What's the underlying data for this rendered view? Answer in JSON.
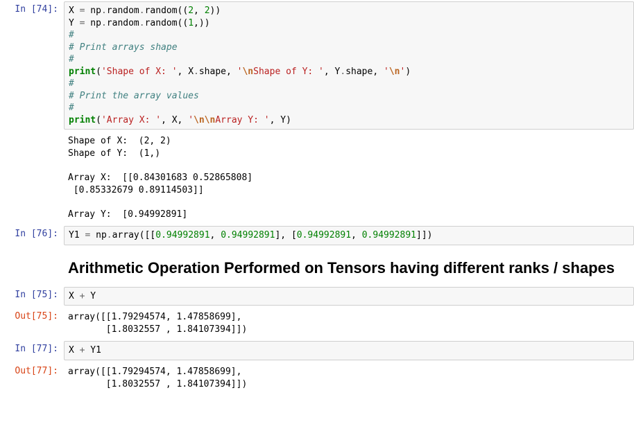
{
  "cells": {
    "c74": {
      "in_label": "In [74]:",
      "code": {
        "l1_a": "X ",
        "l1_eq": "=",
        "l1_b": " np",
        "l1_dot1": ".",
        "l1_c": "random",
        "l1_dot2": ".",
        "l1_d": "random((",
        "l1_n1": "2",
        "l1_e": ", ",
        "l1_n2": "2",
        "l1_f": "))",
        "l2_a": "Y ",
        "l2_eq": "=",
        "l2_b": " np",
        "l2_dot1": ".",
        "l2_c": "random",
        "l2_dot2": ".",
        "l2_d": "random((",
        "l2_n1": "1",
        "l2_e": ",))",
        "l3": "#",
        "l4": "# Print arrays shape",
        "l5": "#",
        "l6_a": "print",
        "l6_b": "(",
        "l6_s1": "'Shape of X: '",
        "l6_c": ", X",
        "l6_dot": ".",
        "l6_d": "shape, ",
        "l6_s2a": "'",
        "l6_esc1": "\\n",
        "l6_s2b": "Shape of Y: '",
        "l6_e": ", Y",
        "l6_dot2": ".",
        "l6_f": "shape, ",
        "l6_s3a": "'",
        "l6_esc2": "\\n",
        "l6_s3b": "'",
        "l6_g": ")",
        "l7": "#",
        "l8": "# Print the array values",
        "l9": "#",
        "l10_a": "print",
        "l10_b": "(",
        "l10_s1": "'Array X: '",
        "l10_c": ", X, ",
        "l10_s2a": "'",
        "l10_esc1": "\\n\\n",
        "l10_s2b": "Array Y: '",
        "l10_d": ", Y)"
      },
      "output": "Shape of X:  (2, 2)\nShape of Y:  (1,)\n\nArray X:  [[0.84301683 0.52865808]\n [0.85332679 0.89114503]]\n\nArray Y:  [0.94992891]"
    },
    "c76": {
      "in_label": "In [76]:",
      "code": {
        "a": "Y1 ",
        "eq": "=",
        "b": " np",
        "dot": ".",
        "c": "array([[",
        "n1": "0.94992891",
        "d": ", ",
        "n2": "0.94992891",
        "e": "], [",
        "n3": "0.94992891",
        "f": ", ",
        "n4": "0.94992891",
        "g": "]])"
      }
    },
    "heading": "Arithmetic Operation Performed on Tensors having different ranks / shapes",
    "c75": {
      "in_label": "In [75]:",
      "out_label": "Out[75]:",
      "code": {
        "a": "X ",
        "op": "+",
        "b": " Y"
      },
      "result": "array([[1.79294574, 1.47858699],\n       [1.8032557 , 1.84107394]])"
    },
    "c77": {
      "in_label": "In [77]:",
      "out_label": "Out[77]:",
      "code": {
        "a": "X ",
        "op": "+",
        "b": " Y1"
      },
      "result": "array([[1.79294574, 1.47858699],\n       [1.8032557 , 1.84107394]])"
    }
  }
}
